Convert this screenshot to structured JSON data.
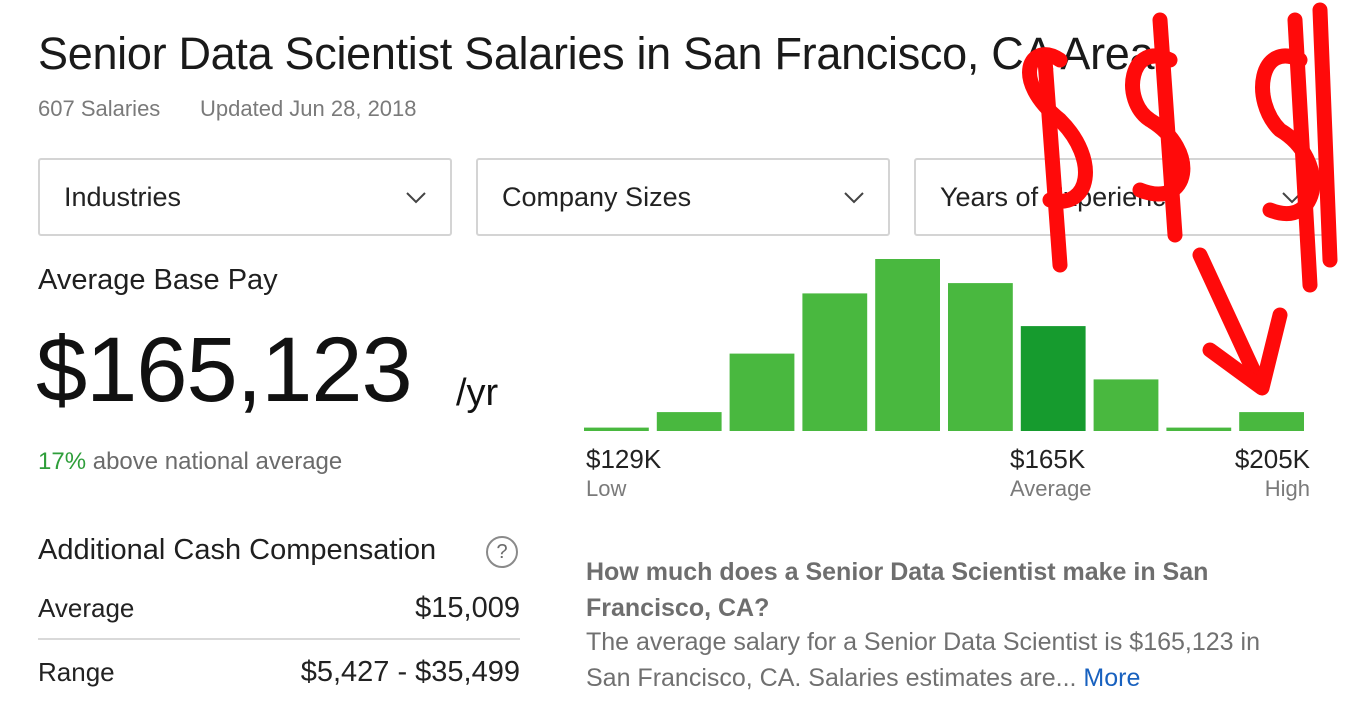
{
  "header": {
    "title": "Senior Data Scientist Salaries in San Francisco, CA Area",
    "salary_count": "607 Salaries",
    "updated": "Updated Jun 28, 2018"
  },
  "filters": [
    {
      "label": "Industries",
      "icon": "chevron-down-icon"
    },
    {
      "label": "Company Sizes",
      "icon": "chevron-down-icon"
    },
    {
      "label": "Years of Experience",
      "icon": "chevron-down-icon"
    }
  ],
  "pay": {
    "heading": "Average Base Pay",
    "amount": "$165,123",
    "unit": "/yr",
    "national_pct": "17%",
    "national_text": " above national average"
  },
  "cash": {
    "heading": "Additional Cash Compensation",
    "help_icon": "?",
    "rows": [
      {
        "label": "Average",
        "value": "$15,009"
      },
      {
        "label": "Range",
        "value": "$5,427 - $35,499"
      }
    ]
  },
  "chart_data": {
    "type": "bar",
    "values": [
      2,
      11,
      45,
      80,
      100,
      86,
      61,
      30,
      2,
      11
    ],
    "highlight_index": 6,
    "labels": [
      {
        "value": "$129K",
        "sub": "Low"
      },
      {
        "value": "$165K",
        "sub": "Average"
      },
      {
        "value": "$205K",
        "sub": "High"
      }
    ],
    "colors": {
      "bar": "#49b83f",
      "highlight": "#169b2e"
    }
  },
  "faq": {
    "question": "How much does a Senior Data Scientist make in San Francisco, CA?",
    "answer": "The average salary for a Senior Data Scientist is $165,123 in San Francisco, CA. Salaries estimates are...",
    "more": "More"
  },
  "annotation": {
    "color": "#ff0a0a",
    "text": "$$$"
  }
}
